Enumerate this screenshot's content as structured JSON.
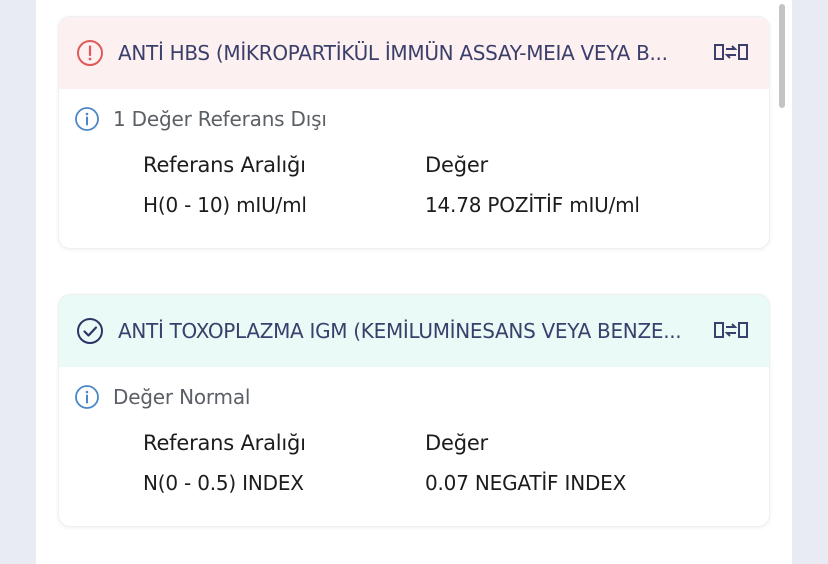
{
  "results": [
    {
      "title": "ANTİ HBS  (MİKROPARTİKÜL İMMÜN ASSAY-MEIA VEYA B...",
      "status": "abnormal",
      "status_color": "#e05a5a",
      "info": "1 Değer Referans Dışı",
      "reference_header": "Referans Aralığı",
      "value_header": "Değer",
      "reference": "H(0 - 10) mIU/ml",
      "value": "14.78 POZİTİF mIU/ml"
    },
    {
      "title": "ANTİ TOXOPLAZMA IGM (KEMİLUMİNESANS VEYA BENZE...",
      "status": "normal",
      "status_color": "#2e3566",
      "info": "Değer Normal",
      "reference_header": "Referans Aralığı",
      "value_header": "Değer",
      "reference": "N(0 - 0.5) INDEX",
      "value": "0.07 NEGATİF INDEX"
    }
  ],
  "icons": {
    "abnormal": "exclamation-circle-icon",
    "normal": "check-circle-icon",
    "info": "info-icon",
    "swap": "swap-icon"
  },
  "colors": {
    "info_blue": "#4a86c8",
    "title_text": "#3a3f6b",
    "abnormal_bg": "#fdf0f0",
    "normal_bg": "#eafaf7"
  }
}
